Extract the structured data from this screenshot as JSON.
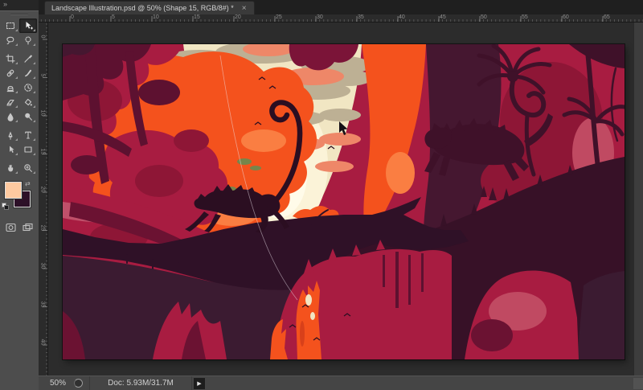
{
  "window": {
    "collapse_glyph": "»",
    "tab": {
      "title": "Landscape Illustration.psd @ 50% (Shape 15, RGB/8#) *",
      "close_glyph": "×"
    }
  },
  "toolbox": {
    "tools": [
      {
        "name": "rectangular-marquee-tool",
        "selected": false
      },
      {
        "name": "move-tool",
        "selected": true
      },
      {
        "name": "lasso-tool",
        "selected": false
      },
      {
        "name": "quick-selection-tool",
        "selected": false
      },
      {
        "name": "crop-tool",
        "selected": false
      },
      {
        "name": "eyedropper-tool",
        "selected": false
      },
      {
        "name": "spot-healing-brush-tool",
        "selected": false
      },
      {
        "name": "brush-tool",
        "selected": false
      },
      {
        "name": "clone-stamp-tool",
        "selected": false
      },
      {
        "name": "history-brush-tool",
        "selected": false
      },
      {
        "name": "eraser-tool",
        "selected": false
      },
      {
        "name": "paint-bucket-tool",
        "selected": false
      },
      {
        "name": "blur-tool",
        "selected": false
      },
      {
        "name": "dodge-tool",
        "selected": false
      },
      {
        "name": "pen-tool",
        "selected": false
      },
      {
        "name": "type-tool",
        "selected": false
      },
      {
        "name": "path-selection-tool",
        "selected": false
      },
      {
        "name": "rectangle-tool",
        "selected": false
      },
      {
        "name": "hand-tool",
        "selected": false
      },
      {
        "name": "zoom-tool",
        "selected": false
      }
    ],
    "foreground_color": "#fdc9a0",
    "background_color": "#2d1028"
  },
  "rulers": {
    "horizontal": [
      "0",
      "5",
      "10",
      "15",
      "20",
      "25",
      "30",
      "35",
      "40",
      "45",
      "50",
      "55",
      "60",
      "65"
    ],
    "vertical": [
      "0",
      "5",
      "10",
      "15",
      "20",
      "25",
      "30",
      "35",
      "40"
    ]
  },
  "statusbar": {
    "zoom_value": "50%",
    "doc_info": "Doc: 5.93M/31.7M",
    "flyout_glyph": "▶"
  },
  "canvas": {
    "palette": {
      "cream": "#f1e6c3",
      "glow": "#fbf3d8",
      "glow2": "#fffbe9",
      "cloud_tan": "#bdb094",
      "cloud_salmon": "#ee8768",
      "cloud_pink": "#f0a287",
      "orange": "#f4521d",
      "orange_light": "#fa7e42",
      "orange_deep": "#d8401a",
      "olive": "#77854b",
      "crimson": "#a81c41",
      "crimson_deep": "#8e1636",
      "crimson_dark": "#7b1438",
      "maroon": "#5d1130",
      "maroon2": "#6b1232",
      "pink": "#c04a62",
      "pink2": "#c0506a",
      "plum": "#451730",
      "plum_dark": "#3f1129",
      "slope": "#371127",
      "hill": "#2f1127",
      "plum_soft": "#3b1b31",
      "silhouette": "#2b0e21",
      "pathline": "rgba(240,232,240,0.5)",
      "cursor": "#161016"
    }
  }
}
